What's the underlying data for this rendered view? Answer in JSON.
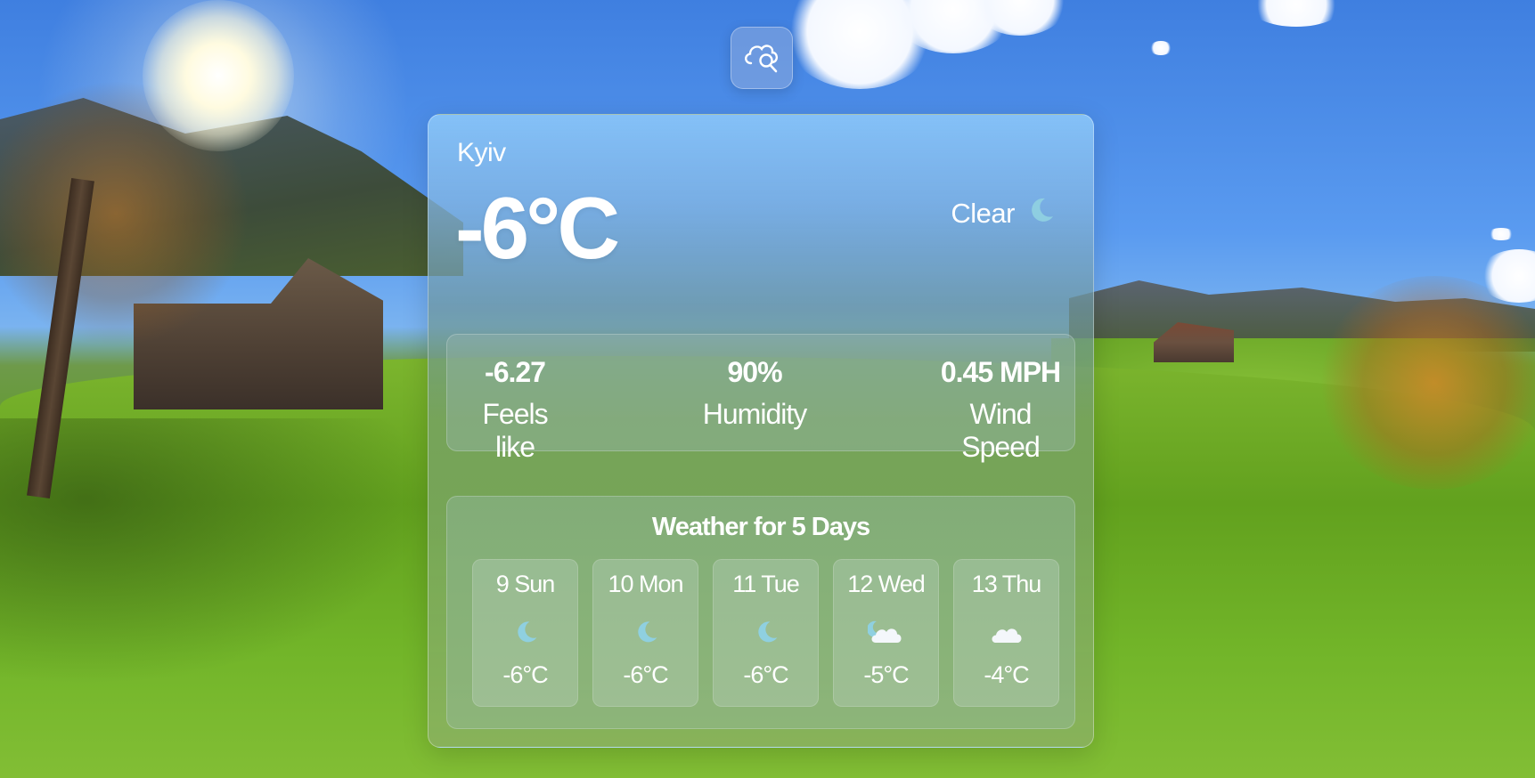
{
  "app": {
    "search_button_icon": "cloud-search-icon"
  },
  "current": {
    "city": "Kyiv",
    "temperature": "-6°C",
    "condition": "Clear",
    "condition_icon": "moon-icon"
  },
  "stats": {
    "feels_like_value": "-6.27",
    "feels_like_label": "Feels like",
    "humidity_value": "90%",
    "humidity_label": "Humidity",
    "wind_value": "0.45 MPH",
    "wind_label": "Wind Speed"
  },
  "forecast": {
    "title": "Weather for 5 Days",
    "days": [
      {
        "name": "9 Sun",
        "icon": "moon-icon",
        "temp": "-6°C"
      },
      {
        "name": "10 Mon",
        "icon": "moon-icon",
        "temp": "-6°C"
      },
      {
        "name": "11 Tue",
        "icon": "moon-icon",
        "temp": "-6°C"
      },
      {
        "name": "12 Wed",
        "icon": "moon-cloud-icon",
        "temp": "-5°C"
      },
      {
        "name": "13 Thu",
        "icon": "cloud-icon",
        "temp": "-4°C"
      }
    ]
  },
  "colors": {
    "text": "#ffffff",
    "moon": "#8fd0e0",
    "cloud": "#f4f7fb"
  }
}
